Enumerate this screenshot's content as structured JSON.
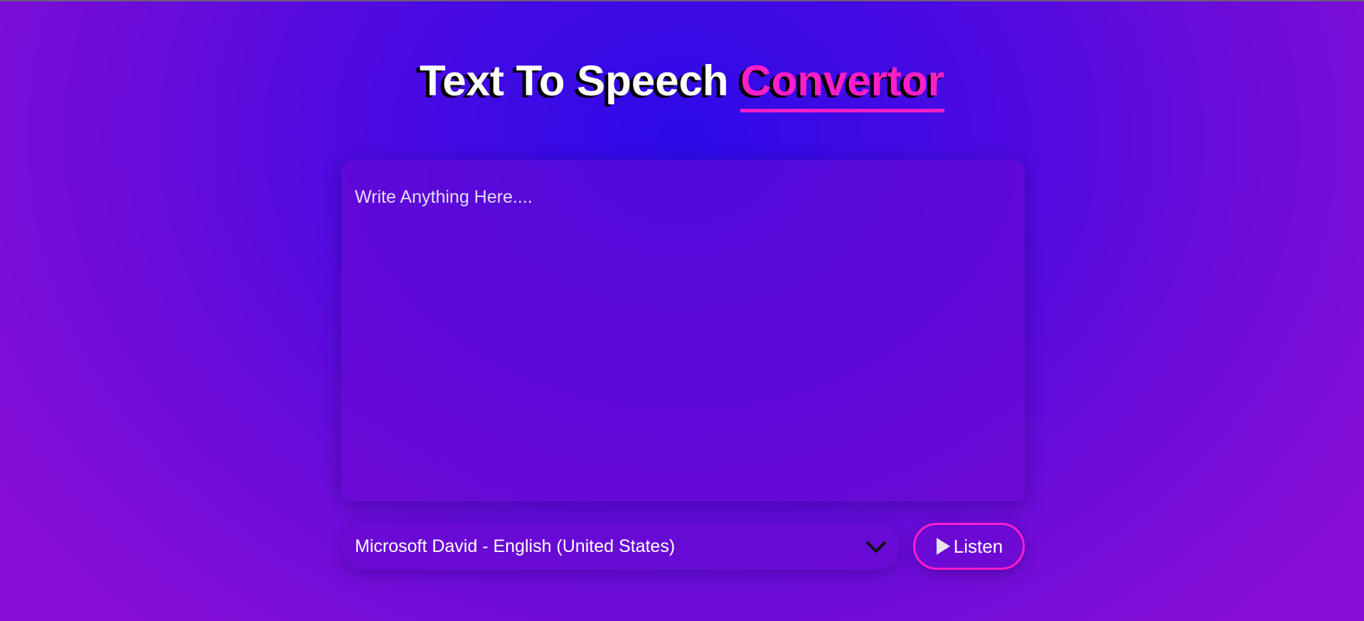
{
  "header": {
    "title_main": "Text To Speech ",
    "title_accent": "Convertor"
  },
  "editor": {
    "placeholder": "Write Anything Here....",
    "value": ""
  },
  "voice_select": {
    "selected": "Microsoft David - English (United States)"
  },
  "listen_button": {
    "label": "Listen",
    "icon": "play-icon"
  },
  "colors": {
    "accent": "#ff1ec8",
    "background_center": "#2d0ae8",
    "background_edge": "#8a0ed6",
    "text": "#ffffff"
  }
}
